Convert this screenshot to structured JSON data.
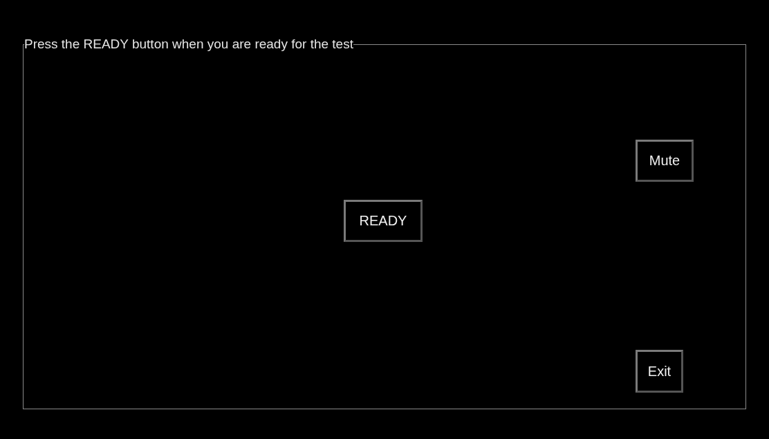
{
  "panel": {
    "legend": "Press the READY button when you are ready for the test"
  },
  "buttons": [
    {
      "kind": "mute",
      "label": "Mute"
    },
    {
      "kind": "ready",
      "label": "READY"
    },
    {
      "kind": "exit",
      "label": "Exit"
    }
  ]
}
